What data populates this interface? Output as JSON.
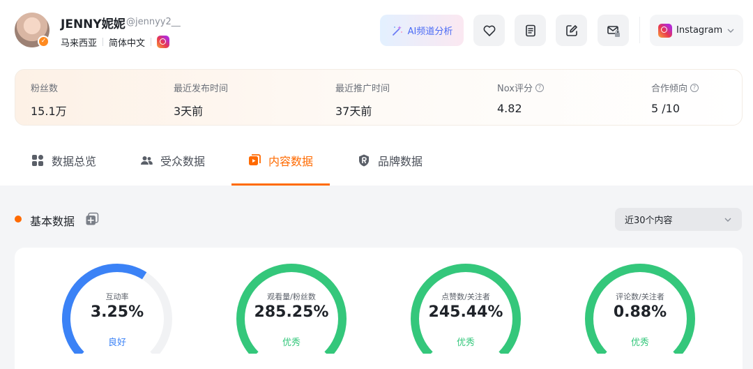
{
  "profile": {
    "name": "JENNY妮妮",
    "handle": "@jennyy2__",
    "country": "马来西亚",
    "language": "简体中文"
  },
  "actions": {
    "ai_label": "AI频道分析",
    "platform": "Instagram"
  },
  "stats": [
    {
      "label": "粉丝数",
      "value": "15.1万",
      "help": false
    },
    {
      "label": "最近发布时间",
      "value": "3天前",
      "help": false
    },
    {
      "label": "最近推广时间",
      "value": "37天前",
      "help": false
    },
    {
      "label": "Nox评分",
      "value": "4.82",
      "help": true
    },
    {
      "label": "合作倾向",
      "value": "5 /10",
      "help": true
    }
  ],
  "tabs": [
    {
      "label": "数据总览",
      "icon": "grid-icon",
      "active": false
    },
    {
      "label": "受众数据",
      "icon": "users-icon",
      "active": false
    },
    {
      "label": "内容数据",
      "icon": "content-icon",
      "active": true
    },
    {
      "label": "品牌数据",
      "icon": "brand-icon",
      "active": false
    }
  ],
  "section": {
    "title": "基本数据",
    "range": "近30个内容"
  },
  "gauges": [
    {
      "label": "互动率",
      "value": "3.25%",
      "grade": "良好",
      "level": 0.62,
      "color": "#3b82f6"
    },
    {
      "label": "观看量/粉丝数",
      "value": "285.25%",
      "grade": "优秀",
      "level": 1.0,
      "color": "#34c77b"
    },
    {
      "label": "点赞数/关注者",
      "value": "245.44%",
      "grade": "优秀",
      "level": 1.0,
      "color": "#34c77b"
    },
    {
      "label": "评论数/关注者",
      "value": "0.88%",
      "grade": "优秀",
      "level": 1.0,
      "color": "#34c77b"
    }
  ],
  "colors": {
    "accent": "#ff6a00",
    "good": "#3b82f6",
    "excellent": "#34c77b"
  }
}
